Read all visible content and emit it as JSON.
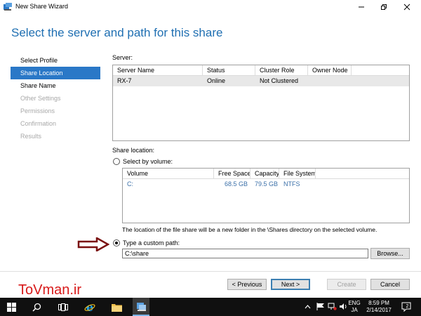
{
  "window": {
    "title": "New Share Wizard",
    "heading": "Select the server and path for this share"
  },
  "nav": {
    "items": [
      {
        "label": "Select Profile",
        "state": "normal"
      },
      {
        "label": "Share Location",
        "state": "active"
      },
      {
        "label": "Share Name",
        "state": "normal"
      },
      {
        "label": "Other Settings",
        "state": "disabled"
      },
      {
        "label": "Permissions",
        "state": "disabled"
      },
      {
        "label": "Confirmation",
        "state": "disabled"
      },
      {
        "label": "Results",
        "state": "disabled"
      }
    ]
  },
  "server": {
    "label": "Server:",
    "columns": [
      "Server Name",
      "Status",
      "Cluster Role",
      "Owner Node"
    ],
    "rows": [
      {
        "name": "RX-7",
        "status": "Online",
        "cluster_role": "Not Clustered",
        "owner_node": ""
      }
    ]
  },
  "share_location": {
    "label": "Share location:",
    "by_volume_label": "Select by volume:",
    "volume_columns": [
      "Volume",
      "Free Space",
      "Capacity",
      "File System"
    ],
    "volumes": [
      {
        "volume": "C:",
        "free_space": "68.5 GB",
        "capacity": "79.5 GB",
        "file_system": "NTFS"
      }
    ],
    "volume_note": "The location of the file share will be a new folder in the \\Shares directory on the selected volume.",
    "custom_path_label": "Type a custom path:",
    "custom_path_value": "C:\\share",
    "browse_label": "Browse...",
    "selected_option": "custom"
  },
  "buttons": {
    "previous": "< Previous",
    "next": "Next >",
    "create": "Create",
    "cancel": "Cancel"
  },
  "watermark": "ToVman.ir",
  "taskbar": {
    "lang_top": "ENG",
    "lang_bottom": "JA",
    "time": "8:59 PM",
    "date": "2/14/2017",
    "notification_count": "2"
  },
  "colors": {
    "heading": "#1f6fb2",
    "nav_active": "#2a78c7",
    "arrow": "#7a1010",
    "watermark": "#d81a1a"
  }
}
